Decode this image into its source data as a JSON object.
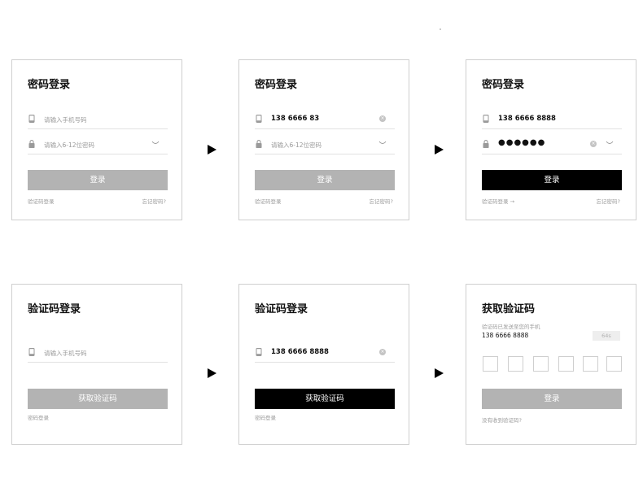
{
  "cards": {
    "c1": {
      "title": "密码登录",
      "phone_placeholder": "请输入手机号码",
      "password_placeholder": "请输入6-12位密码",
      "login_button": "登录",
      "sms_login_link": "验证码登录",
      "forgot_link": "忘记密码?"
    },
    "c2": {
      "title": "密码登录",
      "phone_value": "138 6666 83",
      "password_placeholder": "请输入6-12位密码",
      "login_button": "登录",
      "sms_login_link": "验证码登录",
      "forgot_link": "忘记密码?"
    },
    "c3": {
      "title": "密码登录",
      "phone_value": "138 6666 8888",
      "password_value": "●●●●●●",
      "login_button": "登录",
      "sms_login_link": "验证码登录 →",
      "forgot_link": "忘记密码?"
    },
    "c4": {
      "title": "验证码登录",
      "phone_placeholder": "请输入手机号码",
      "get_code_button": "获取验证码",
      "password_login_link": "密码登录"
    },
    "c5": {
      "title": "验证码登录",
      "phone_value": "138 6666 8888",
      "get_code_button": "获取验证码",
      "password_login_link": "密码登录"
    },
    "c6": {
      "title": "获取验证码",
      "sent_notice": "验证码已发送至您的手机",
      "phone": "138 6666 8888",
      "countdown": "64s",
      "login_button": "登录",
      "no_code_link": "没有收到验证码?"
    }
  },
  "colors": {
    "primary_active": "#000000",
    "button_disabled": "#b3b3b3",
    "placeholder": "#9a9a9a",
    "border": "#cfcfcf"
  },
  "icons": {
    "phone": "phone-icon",
    "lock": "lock-icon",
    "clear": "clear-icon",
    "eye": "eye-closed-icon",
    "arrow": "arrow-right-icon"
  }
}
